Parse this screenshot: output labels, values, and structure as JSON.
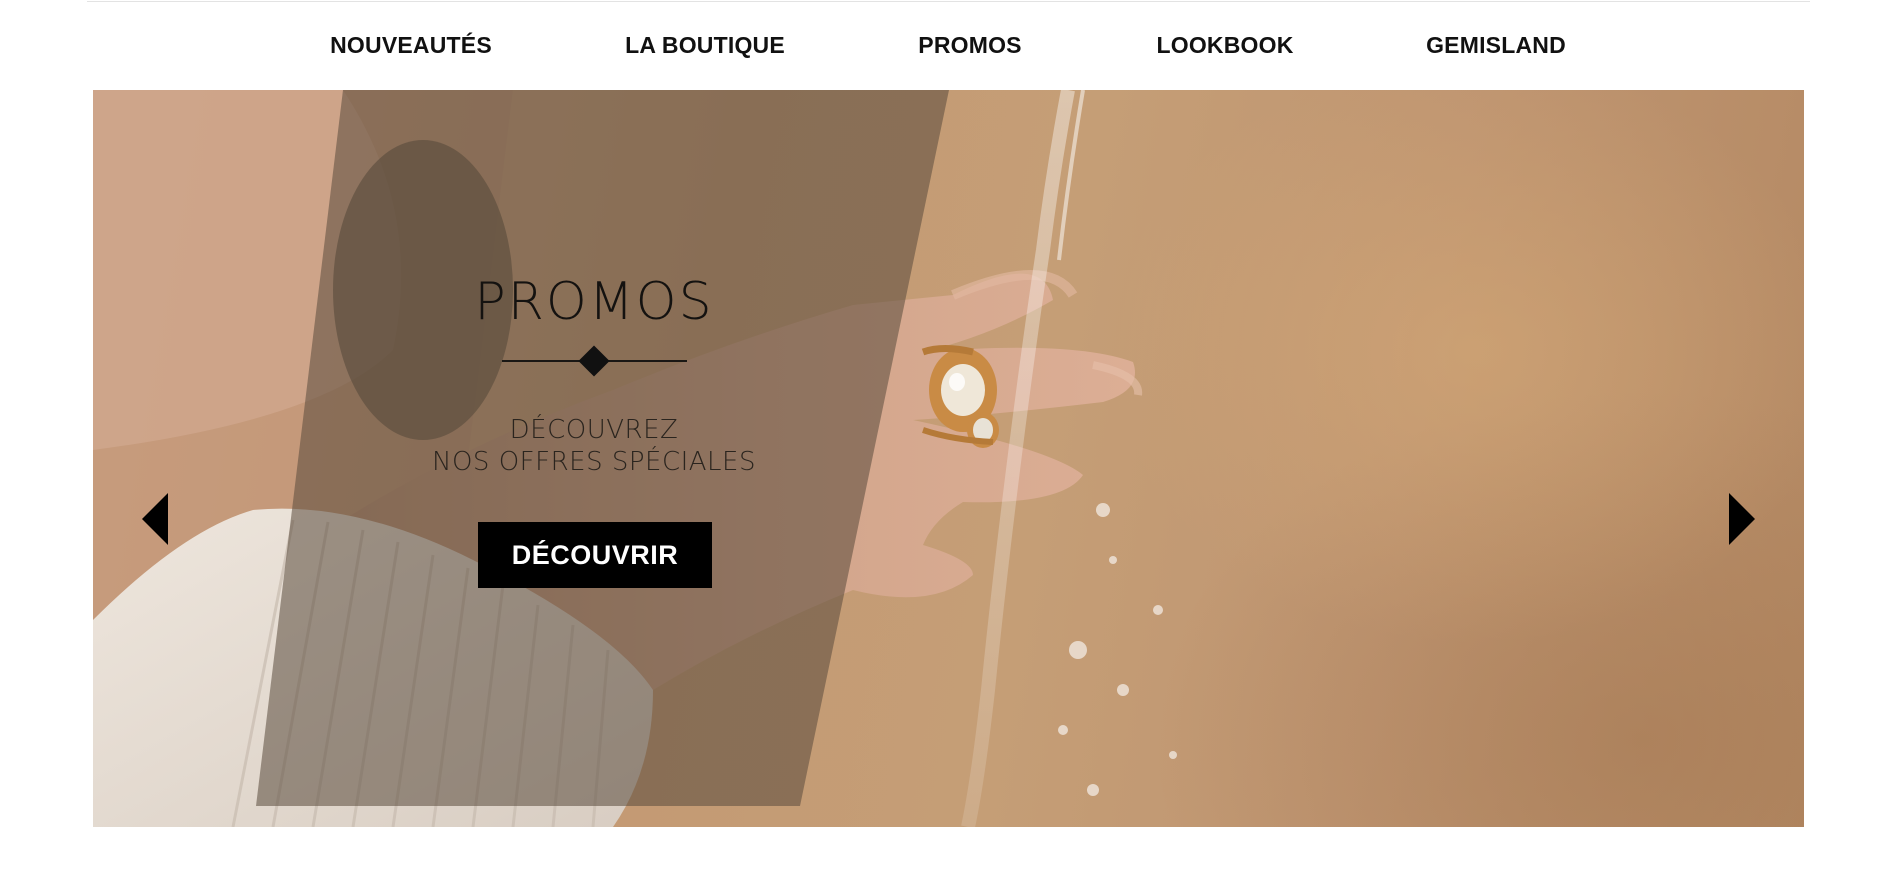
{
  "nav": {
    "items": [
      {
        "label": "NOUVEAUTÉS"
      },
      {
        "label": "LA BOUTIQUE"
      },
      {
        "label": "PROMOS"
      },
      {
        "label": "LOOKBOOK"
      },
      {
        "label": "GEMISLAND"
      }
    ]
  },
  "hero": {
    "title": "PROMOS",
    "subtitle_line1": "DÉCOUVREZ",
    "subtitle_line2": "NOS OFFRES SPÉCIALES",
    "cta_label": "DÉCOUVRIR",
    "image_subject": "hand wearing gold pearl rings under running water",
    "colors": {
      "cta_background": "#000000",
      "cta_text": "#ffffff",
      "overlay": "#5a4a3c"
    }
  },
  "carousel": {
    "prev_icon": "triangle-left-icon",
    "next_icon": "triangle-right-icon"
  }
}
